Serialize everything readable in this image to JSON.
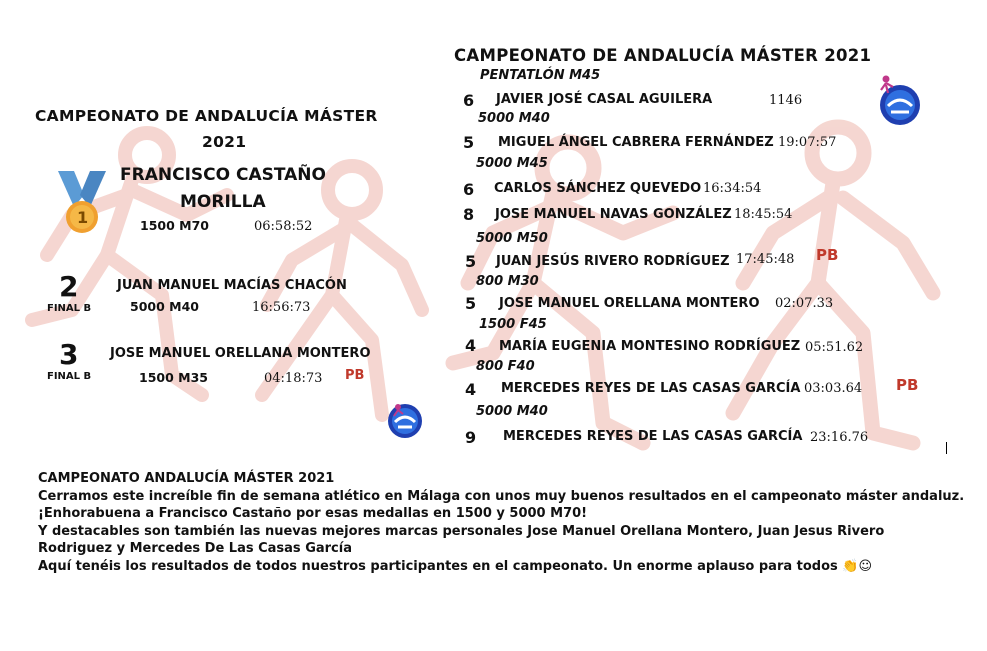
{
  "left_panel": {
    "title_line1": "CAMPEONATO DE ANDALUCÍA MÁSTER",
    "title_line2": "2021",
    "medal_number": "1",
    "winner_line1": "FRANCISCO CASTAÑO",
    "winner_line2": "MORILLA",
    "winner_event": "1500 M70",
    "winner_time": "06:58:52",
    "rows": [
      {
        "place": "2",
        "final": "FINAL B",
        "name": "JUAN MANUEL MACÍAS CHACÓN",
        "event": "5000 M40",
        "time": "16:56:73",
        "pb": ""
      },
      {
        "place": "3",
        "final": "FINAL B",
        "name": "JOSE MANUEL ORELLANA MONTERO",
        "event": "1500 M35",
        "time": "04:18:73",
        "pb": "PB"
      }
    ]
  },
  "right_panel": {
    "title": "CAMPEONATO DE ANDALUCÍA MÁSTER 2021",
    "results": [
      {
        "event": "PENTATLÓN M45",
        "place": "6",
        "name": "JAVIER JOSÉ CASAL AGUILERA",
        "value": "1146",
        "pb": ""
      },
      {
        "event": "5000 M40",
        "place": "5",
        "name": "MIGUEL ÁNGEL CABRERA FERNÁNDEZ",
        "value": "19:07:57",
        "pb": ""
      },
      {
        "event": "5000 M45",
        "place": "6",
        "name": "CARLOS SÁNCHEZ QUEVEDO",
        "value": "16:34:54",
        "pb": ""
      },
      {
        "event": "",
        "place": "8",
        "name": "JOSE MANUEL NAVAS GONZÁLEZ",
        "value": "18:45:54",
        "pb": ""
      },
      {
        "event": "5000 M50",
        "place": "5",
        "name": "JUAN JESÚS RIVERO RODRÍGUEZ",
        "value": "17:45:48",
        "pb": "PB"
      },
      {
        "event": "800 M30",
        "place": "5",
        "name": "JOSE MANUEL ORELLANA MONTERO",
        "value": "02:07.33",
        "pb": ""
      },
      {
        "event": "1500 F45",
        "place": "4",
        "name": "MARÍA EUGENIA MONTESINO RODRÍGUEZ",
        "value": "05:51.62",
        "pb": ""
      },
      {
        "event": "800 F40",
        "place": "4",
        "name": "MERCEDES REYES DE LAS CASAS GARCÍA",
        "value": "03:03.64",
        "pb": "PB"
      },
      {
        "event": "5000 M40",
        "place": "9",
        "name": "MERCEDES REYES DE LAS CASAS GARCÍA",
        "value": "23:16.76",
        "pb": ""
      }
    ]
  },
  "post": {
    "lines": [
      "CAMPEONATO ANDALUCÍA MÁSTER 2021",
      "Cerramos este increíble fin de semana atlético en Málaga con unos muy buenos resultados en el campeonato máster andaluz.",
      "¡Enhorabuena a Francisco Castaño por esas medallas en 1500 y 5000 M70!",
      "Y destacables son también las nuevas mejores marcas personales  Jose Manuel Orellana Montero, Juan Jesus Rivero",
      "Rodriguez y Mercedes De Las Casas García",
      "Aquí tenéis los resultados de todos nuestros participantes en el campeonato. Un enorme aplauso para todos 👏☺"
    ]
  },
  "colors": {
    "figure": "#f2c9c2",
    "medal_ribbon": "#5b9bd5",
    "medal_gold": "#f0a030",
    "pb": "#c0392b",
    "logo_blue": "#1f3fb0"
  },
  "icons": {
    "medal": "gold-medal-icon",
    "logo": "club-logo-icon",
    "background": "runner-silhouette"
  }
}
